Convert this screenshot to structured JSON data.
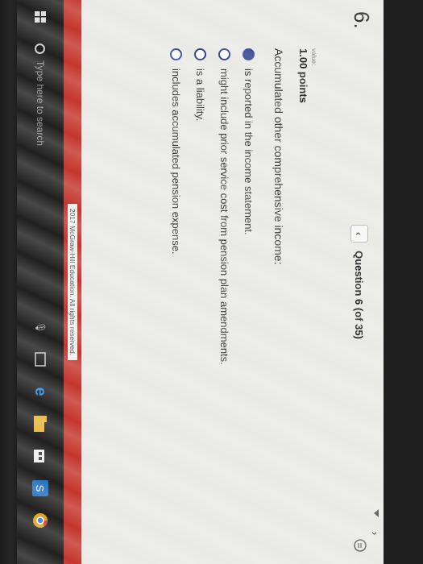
{
  "question": {
    "number": "6.",
    "counter": "Question 6 (of 35)",
    "value_label": "value:",
    "points": "1.00 points",
    "prompt": "Accumulated other comprehensive income:",
    "options": [
      {
        "text": "is reported in the income statement.",
        "selected": true
      },
      {
        "text": "might include prior service cost from pension plan amendments.",
        "selected": false
      },
      {
        "text": "is a liability.",
        "selected": false
      },
      {
        "text": "includes accumulated pension expense.",
        "selected": false
      }
    ]
  },
  "footer": {
    "copyright": "2017 McGraw-Hill Education. All rights reserved."
  },
  "taskbar": {
    "search_placeholder": "Type here to search"
  },
  "colors": {
    "accent": "#2a3f8a",
    "footer_bar": "#c4362d",
    "taskbar": "#202020"
  }
}
